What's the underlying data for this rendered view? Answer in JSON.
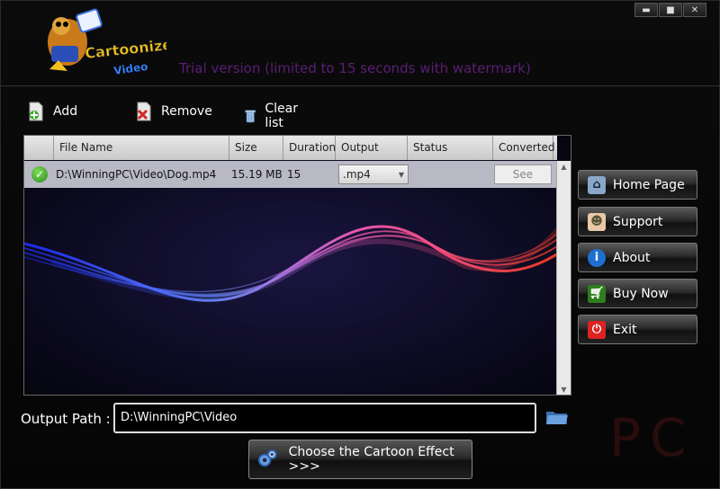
{
  "app": {
    "logo_text_line1": "Cartoonize",
    "logo_text_line2": "Video",
    "trial_notice": "Trial version (limited to 15 seconds with watermark)"
  },
  "window_controls": {
    "minimize": "▬",
    "maximize": "■",
    "close": "✕"
  },
  "toolbar": {
    "add_label": "Add",
    "remove_label": "Remove",
    "clear_label": "Clear list"
  },
  "table": {
    "columns": [
      "File Name",
      "Size",
      "Duration",
      "Output Type",
      "Status",
      "Converted"
    ],
    "rows": [
      {
        "file_name": "D:\\WinningPC\\Video\\Dog.mp4",
        "size": "15.19 MB",
        "duration": "15",
        "output_type": ".mp4",
        "status": "",
        "converted_button": "See"
      }
    ]
  },
  "side_buttons": {
    "home": "Home Page",
    "support": "Support",
    "about": "About",
    "buy": "Buy Now",
    "exit": "Exit"
  },
  "output": {
    "label": "Output Path :",
    "path": "D:\\WinningPC\\Video"
  },
  "choose_effect_label": "Choose the Cartoon Effect >>>",
  "colors": {
    "trial_text": "#5b1d73",
    "row_selected": "#b9b9c6"
  }
}
